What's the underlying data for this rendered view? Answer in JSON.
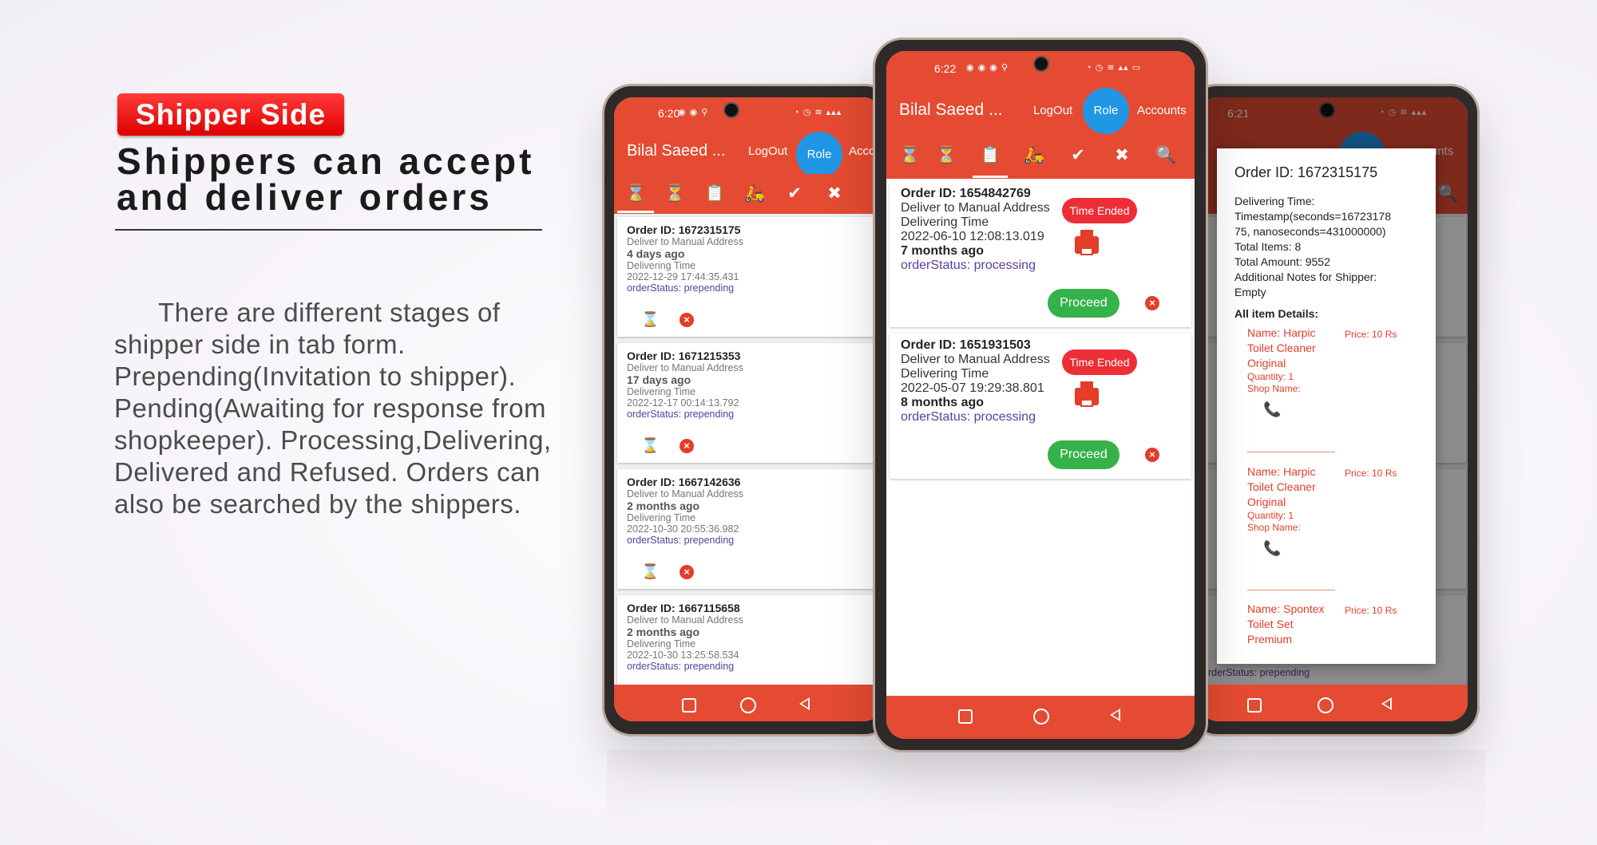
{
  "promo": {
    "badge": "Shipper Side",
    "headline": "Shippers can accept and deliver orders",
    "description_first": "There are different stages of",
    "description_rest": "shipper side in tab form. Prepending(Invitation to shipper). Pending(Awaiting for response from shopkeeper). Processing,Delivering, Delivered and Refused. Orders can also be searched by the shippers."
  },
  "colors": {
    "app_bar": "#e44b32",
    "role_button": "#2196e5",
    "status_text": "#5a3ea0",
    "proceed": "#35b24a",
    "time_ended": "#ee2e36"
  },
  "tabs_icons": [
    "hourglass-empty-icon",
    "hourglass-full-icon",
    "clipboard-clock-icon",
    "scooter-icon",
    "check-circle-icon",
    "cancel-circle-icon",
    "search-icon"
  ],
  "left_phone": {
    "status_time": "6:20",
    "title": "Bilal Saeed ...",
    "logout": "LogOut",
    "role": "Role",
    "accounts": "Accoun",
    "orders": [
      {
        "id": "Order ID: 1672315175",
        "address": "Deliver to Manual Address",
        "ago": "4 days ago",
        "delivering": "Delivering Time",
        "datetime": "2022-12-29 17:44:35.431",
        "status": "orderStatus: prepending"
      },
      {
        "id": "Order ID: 1671215353",
        "address": "Deliver to Manual Address",
        "ago": "17 days ago",
        "delivering": "Delivering Time",
        "datetime": "2022-12-17 00:14:13.792",
        "status": "orderStatus: prepending"
      },
      {
        "id": "Order ID: 1667142636",
        "address": "Deliver to Manual Address",
        "ago": "2 months ago",
        "delivering": "Delivering Time",
        "datetime": "2022-10-30 20:55:36.982",
        "status": "orderStatus: prepending"
      },
      {
        "id": "Order ID: 1667115658",
        "address": "Deliver to Manual Address",
        "ago": "2 months ago",
        "delivering": "Delivering Time",
        "datetime": "2022-10-30 13:25:58.534",
        "status": "orderStatus: prepending"
      }
    ]
  },
  "middle_phone": {
    "status_time": "6:22",
    "title": "Bilal Saeed ...",
    "logout": "LogOut",
    "role": "Role",
    "accounts": "Accounts",
    "orders": [
      {
        "id": "Order ID: 1654842769",
        "address": "Deliver to Manual Address",
        "delivering": "Delivering Time",
        "datetime": "2022-06-10 12:08:13.019",
        "ago": "7 months ago",
        "status": "orderStatus: processing",
        "time_ended": "Time Ended",
        "proceed": "Proceed"
      },
      {
        "id": "Order ID: 1651931503",
        "address": "Deliver to Manual Address",
        "delivering": "Delivering Time",
        "datetime": "2022-05-07 19:29:38.801",
        "ago": "8 months ago",
        "status": "orderStatus: processing",
        "time_ended": "Time Ended",
        "proceed": "Proceed"
      }
    ]
  },
  "right_phone": {
    "status_time": "6:21",
    "accounts_partial": "unts",
    "bg_status": "orderStatus: prepending",
    "dialog": {
      "order_id": "Order ID: 1672315175",
      "delivering_time_label": "Delivering Time:",
      "timestamp_1": "Timestamp(seconds=16723178",
      "timestamp_2": "75, nanoseconds=431000000)",
      "total_items": "Total Items:  8",
      "total_amount": "Total Amount:  9552",
      "notes_label": "Additional Notes for Shipper:",
      "notes_value": "Empty",
      "all_items": "All item Details:",
      "items": [
        {
          "name_1": "Name: Harpic",
          "name_2": "Toilet Cleaner",
          "name_3": "Original",
          "price": "Price: 10 Rs",
          "quantity": "Quantity: 1",
          "shop": "Shop Name:"
        },
        {
          "name_1": "Name: Harpic",
          "name_2": "Toilet Cleaner",
          "name_3": "Original",
          "price": "Price: 10 Rs",
          "quantity": "Quantity: 1",
          "shop": "Shop Name:"
        },
        {
          "name_1": "Name: Spontex",
          "name_2": "Toilet Set",
          "name_3": "Premium",
          "price": "Price: 10 Rs"
        }
      ]
    }
  }
}
